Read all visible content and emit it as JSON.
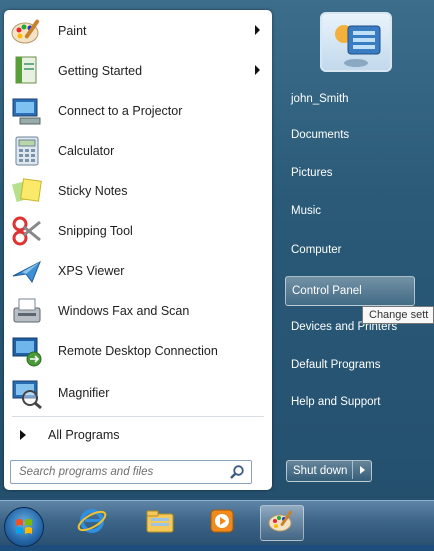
{
  "start_menu": {
    "programs": [
      {
        "label": "Paint",
        "icon": "paint-icon",
        "has_submenu": true
      },
      {
        "label": "Getting Started",
        "icon": "getting-started-icon",
        "has_submenu": true
      },
      {
        "label": "Connect to a Projector",
        "icon": "projector-icon",
        "has_submenu": false
      },
      {
        "label": "Calculator",
        "icon": "calculator-icon",
        "has_submenu": false
      },
      {
        "label": "Sticky Notes",
        "icon": "sticky-notes-icon",
        "has_submenu": false
      },
      {
        "label": "Snipping Tool",
        "icon": "scissors-icon",
        "has_submenu": false
      },
      {
        "label": "XPS Viewer",
        "icon": "xps-viewer-icon",
        "has_submenu": false
      },
      {
        "label": "Windows Fax and Scan",
        "icon": "fax-icon",
        "has_submenu": false
      },
      {
        "label": "Remote Desktop Connection",
        "icon": "remote-desktop-icon",
        "has_submenu": false
      },
      {
        "label": "Magnifier",
        "icon": "magnifier-icon",
        "has_submenu": false
      }
    ],
    "all_programs_label": "All Programs",
    "search": {
      "placeholder": "Search programs and files"
    },
    "right_pane": [
      {
        "label": "john_Smith"
      },
      {
        "label": "Documents"
      },
      {
        "label": "Pictures"
      },
      {
        "label": "Music"
      },
      {
        "label": "Computer"
      },
      {
        "label": "Control Panel",
        "hover": true
      },
      {
        "label": "Devices and Printers"
      },
      {
        "label": "Default Programs"
      },
      {
        "label": "Help and Support"
      }
    ],
    "tooltip": "Change sett",
    "shutdown_label": "Shut down"
  },
  "taskbar": {
    "items": [
      {
        "icon": "start-orb-icon"
      },
      {
        "icon": "internet-explorer-icon"
      },
      {
        "icon": "file-explorer-icon"
      },
      {
        "icon": "media-player-icon"
      },
      {
        "icon": "paint-icon",
        "active": true
      }
    ]
  },
  "colors": {
    "menu_bg": "#2a5a78",
    "left_pane": "#ffffff",
    "taskbar": "#3d6588"
  }
}
